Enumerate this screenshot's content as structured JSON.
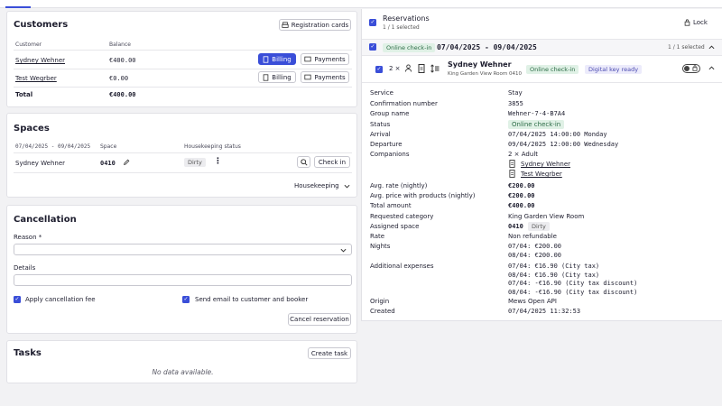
{
  "customers": {
    "title": "Customers",
    "registration_label": "Registration cards",
    "col_customer": "Customer",
    "col_balance": "Balance",
    "rows": [
      {
        "name": "Sydney Wehner",
        "balance": "€400.00",
        "billing": "Billing",
        "payments": "Payments"
      },
      {
        "name": "Test Wegrber",
        "balance": "€0.00",
        "billing": "Billing",
        "payments": "Payments"
      }
    ],
    "total_label": "Total",
    "total_value": "€400.00"
  },
  "spaces": {
    "title": "Spaces",
    "col_dates": "07/04/2025 - 09/04/2025",
    "col_space": "Space",
    "col_housekeeping": "Housekeeping status",
    "row": {
      "name": "Sydney Wehner",
      "space": "0410",
      "status": "Dirty",
      "checkin": "Check in"
    },
    "housekeeping_label": "Housekeeping"
  },
  "cancellation": {
    "title": "Cancellation",
    "reason_label": "Reason *",
    "details_label": "Details",
    "fee_label": "Apply cancellation fee",
    "email_label": "Send email to customer and booker",
    "cancel_button": "Cancel reservation"
  },
  "tasks": {
    "title": "Tasks",
    "create_button": "Create task",
    "empty": "No data available."
  },
  "reservations": {
    "title": "Reservations",
    "subtitle": "1 / 1 selected",
    "lock_label": "Lock",
    "group": {
      "badge": "Online check-in",
      "dates": "07/04/2025 - 09/04/2025",
      "selected": "1 / 1 selected"
    },
    "item": {
      "count": "2 ×",
      "name": "Sydney Wehner",
      "room": "King Garden View Room 0410",
      "badge1": "Online check-in",
      "badge2": "Digital key ready"
    },
    "details": {
      "service_label": "Service",
      "service": "Stay",
      "confirmation_label": "Confirmation number",
      "confirmation": "3855",
      "group_label": "Group name",
      "group": "Wehner-7-4-B7A4",
      "status_label": "Status",
      "status": "Online check-in",
      "arrival_label": "Arrival",
      "arrival": "07/04/2025 14:00:00 Monday",
      "departure_label": "Departure",
      "departure": "09/04/2025 12:00:00 Wednesday",
      "companions_label": "Companions",
      "companions": "2 × Adult",
      "companion1": "Sydney Wehner",
      "companion2": "Test Wegrber",
      "avg_rate_label": "Avg. rate (nightly)",
      "avg_rate": "€200.00",
      "avg_price_label": "Avg. price with products (nightly)",
      "avg_price": "€200.00",
      "total_label": "Total amount",
      "total": "€400.00",
      "category_label": "Requested category",
      "category": "King Garden View Room",
      "assigned_label": "Assigned space",
      "assigned": "0410",
      "assigned_status": "Dirty",
      "rate_label": "Rate",
      "rate": "Non refundable",
      "nights_label": "Nights",
      "night1": "07/04: €200.00",
      "night2": "08/04: €200.00",
      "expenses_label": "Additional expenses",
      "expense1": "07/04: €16.90 (City tax)",
      "expense2": "08/04: €16.90 (City tax)",
      "expense3": "07/04: -€16.90 (City tax discount)",
      "expense4": "08/04: -€16.90 (City tax discount)",
      "origin_label": "Origin",
      "origin": "Mews Open API",
      "created_label": "Created",
      "created": "07/04/2025 11:32:53"
    }
  },
  "colors": {
    "accent": "#3a4ed8",
    "badge_green": "#e0f1e6",
    "badge_purple": "#ecebfb",
    "badge_gray": "#ececef"
  }
}
